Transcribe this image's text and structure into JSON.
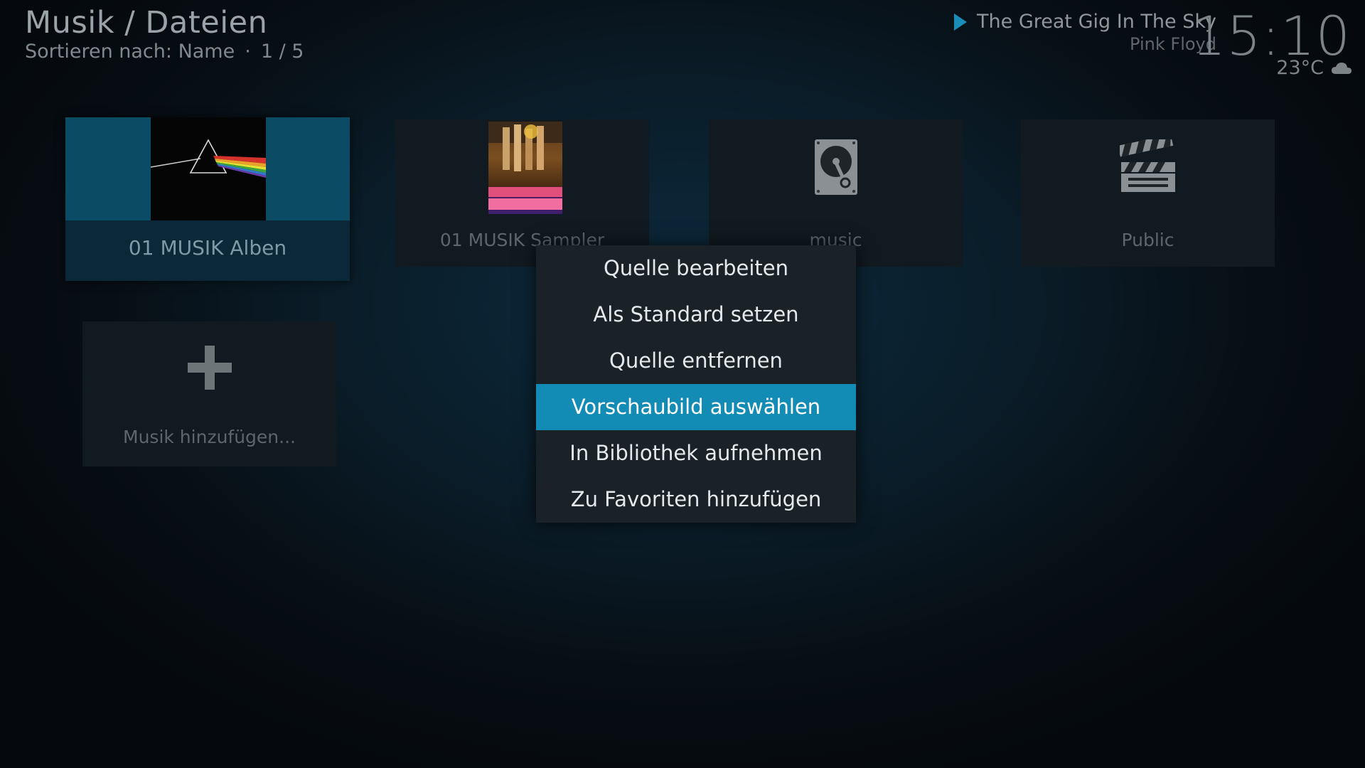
{
  "header": {
    "title": "Musik / Dateien",
    "sort_label": "Sortieren nach: Name",
    "separator": "·",
    "page_counter": "1 / 5"
  },
  "now_playing": {
    "title": "The Great Gig In The Sky",
    "artist": "Pink Floyd"
  },
  "clock": {
    "time": "15:10",
    "temperature": "23°C",
    "weather_icon": "cloud-icon"
  },
  "tiles": [
    {
      "label": "01 MUSIK Alben",
      "icon": "prism-album-art",
      "focused": true
    },
    {
      "label": "01 MUSIK Sampler",
      "icon": "album-cover-art",
      "focused": false
    },
    {
      "label": "music",
      "icon": "hard-drive-icon",
      "focused": false
    },
    {
      "label": "Public",
      "icon": "clapperboard-icon",
      "focused": false
    }
  ],
  "add_tile": {
    "label": "Musik hinzufügen...",
    "icon": "plus-icon"
  },
  "context_menu": {
    "items": [
      {
        "label": "Quelle bearbeiten",
        "selected": false
      },
      {
        "label": "Als Standard setzen",
        "selected": false
      },
      {
        "label": "Quelle entfernen",
        "selected": false
      },
      {
        "label": "Vorschaubild auswählen",
        "selected": true
      },
      {
        "label": "In Bibliothek aufnehmen",
        "selected": false
      },
      {
        "label": "Zu Favoriten hinzufügen",
        "selected": false
      }
    ]
  },
  "colors": {
    "accent": "#128bb5",
    "focused_tile": "#0b4b63",
    "menu_bg": "#1a2227"
  }
}
